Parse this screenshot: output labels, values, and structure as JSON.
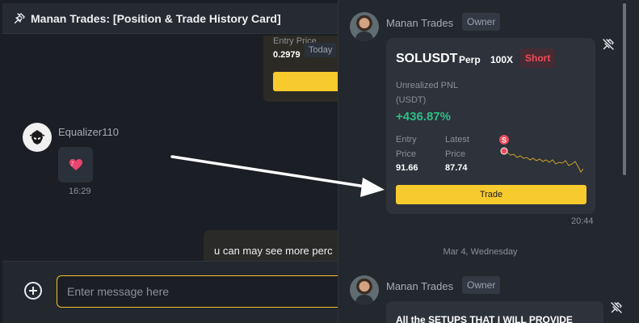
{
  "left_pane": {
    "header": {
      "title": "Manan Trades: [Position & Trade History Card]",
      "icon": "pin-icon"
    },
    "partial_card": {
      "entry_label": "Entry Price",
      "entry_value": "0.2979",
      "today_badge": "Today"
    },
    "message_1": {
      "sender": "Equalizer110",
      "content_icon": "heart-emoji",
      "time": "16:29"
    },
    "message_2": {
      "text": "u can may see more perc"
    },
    "composer": {
      "placeholder": "Enter message here",
      "value": "",
      "attach_icon": "plus-circle-icon"
    }
  },
  "right_pane": {
    "post_1": {
      "author": "Manan Trades",
      "role_badge": "Owner",
      "card": {
        "symbol": "SOLUSDT",
        "contract_type": "Perp",
        "leverage": "100X",
        "side": "Short",
        "pnl_label": "Unrealized PNL (USDT)",
        "pnl_value": "+436.87%",
        "entry_label": "Entry Price",
        "entry_value": "91.66",
        "latest_label": "Latest Price",
        "latest_value": "87.74",
        "marker_label": "S",
        "trade_button": "Trade"
      },
      "time": "20:44"
    },
    "date_separator": "Mar 4, Wednesday",
    "post_2": {
      "author": "Manan Trades",
      "role_badge": "Owner",
      "text": "All the SETUPS THAT I WILL PROVIDE"
    }
  },
  "colors": {
    "accent": "#f7ca2d",
    "positive": "#2fbd85",
    "short": "#f04b5a",
    "background": "#1b1e24",
    "panel": "#23272e",
    "card": "#2d323b"
  }
}
